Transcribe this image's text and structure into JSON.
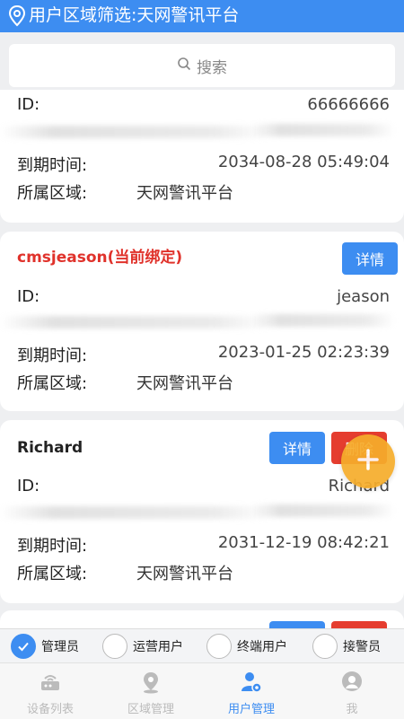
{
  "header": {
    "title": "用户区域筛选:天网警讯平台"
  },
  "search": {
    "placeholder": "搜索"
  },
  "cards": [
    {
      "id_label": "ID:",
      "id_value": "66666666",
      "blur_value": "10",
      "expire_label": "到期时间:",
      "expire_value": "2034-08-28 05:49:04",
      "region_label": "所属区域:",
      "region_value": "天网警讯平台"
    },
    {
      "name": "cmsjeason(当前绑定)",
      "detail_label": "详情",
      "id_label": "ID:",
      "id_value": "jeason",
      "expire_label": "到期时间:",
      "expire_value": "2023-01-25 02:23:39",
      "region_label": "所属区域:",
      "region_value": "天网警讯平台"
    },
    {
      "name": "Richard",
      "detail_label": "详情",
      "delete_label": "删除",
      "id_label": "ID:",
      "id_value": "Richard",
      "expire_label": "到期时间:",
      "expire_value": "2031-12-19 08:42:21",
      "region_label": "所属区域:",
      "region_value": "天网警讯平台"
    }
  ],
  "roles": [
    {
      "label": "管理员",
      "checked": true
    },
    {
      "label": "运营用户",
      "checked": false
    },
    {
      "label": "终端用户",
      "checked": false
    },
    {
      "label": "接警员",
      "checked": false
    }
  ],
  "tabs": [
    {
      "label": "设备列表",
      "icon": "router-icon",
      "active": false
    },
    {
      "label": "区域管理",
      "icon": "map-pin-icon",
      "active": false
    },
    {
      "label": "用户管理",
      "icon": "user-manage-icon",
      "active": true
    },
    {
      "label": "我",
      "icon": "person-icon",
      "active": false
    }
  ],
  "colors": {
    "accent": "#3d8df1",
    "danger": "#e53d2f",
    "fab": "#f6ad2b",
    "bound_name": "#e0322b"
  }
}
